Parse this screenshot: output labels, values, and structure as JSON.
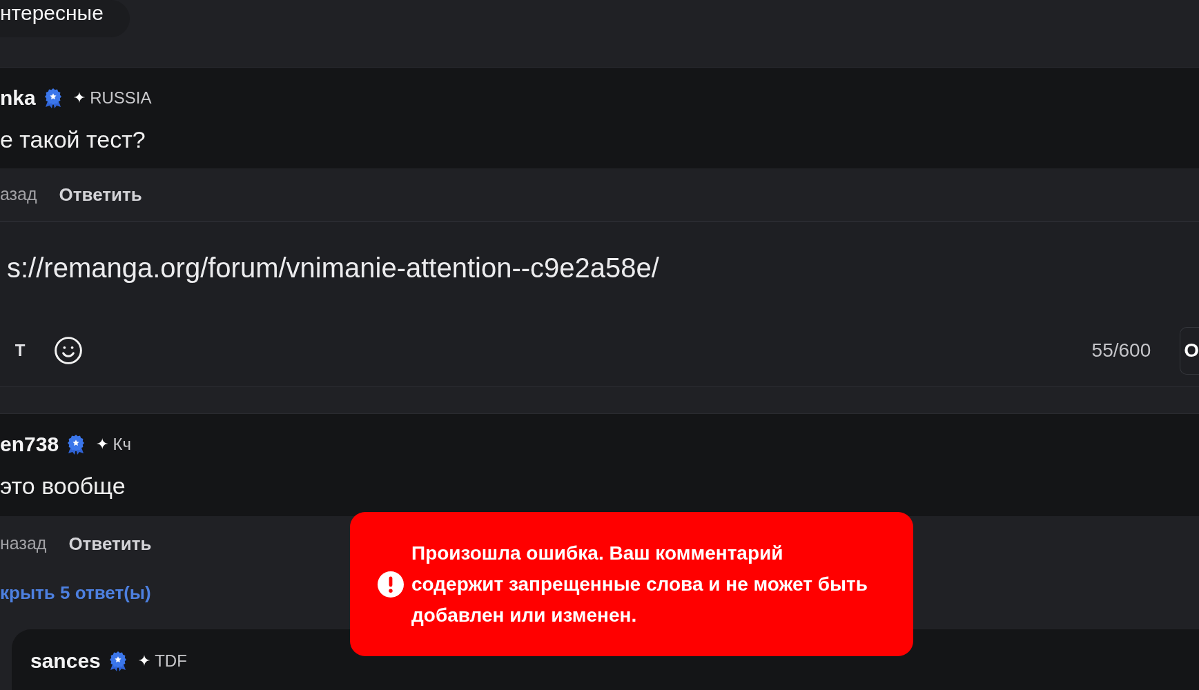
{
  "filter_chip": {
    "label": "нтересные"
  },
  "comments": [
    {
      "author": "nka",
      "verified": true,
      "mark": "✦",
      "tag": "RUSSIA",
      "text": "е такой тест?",
      "time": "азад",
      "reply_label": "Ответить",
      "reply_form": {
        "value": "s://remanga.org/forum/vnimanie-attention--c9e2a58e/",
        "format_button": "T",
        "counter": "55/600",
        "submit_label": "О"
      }
    },
    {
      "author": "en738",
      "verified": true,
      "mark": "✦",
      "tag": "Кч",
      "text": "это вообще",
      "time": "назад",
      "reply_label": "Ответить",
      "replies_toggle": "крыть 5 ответ(ы)",
      "replies": [
        {
          "author": "sances",
          "verified": true,
          "mark": "✦",
          "tag": "TDF"
        }
      ]
    }
  ],
  "toast": {
    "kind": "error",
    "message": "Произошла ошибка. Ваш комментарий содержит запрещенные слова и не может быть добавлен или изменен."
  }
}
